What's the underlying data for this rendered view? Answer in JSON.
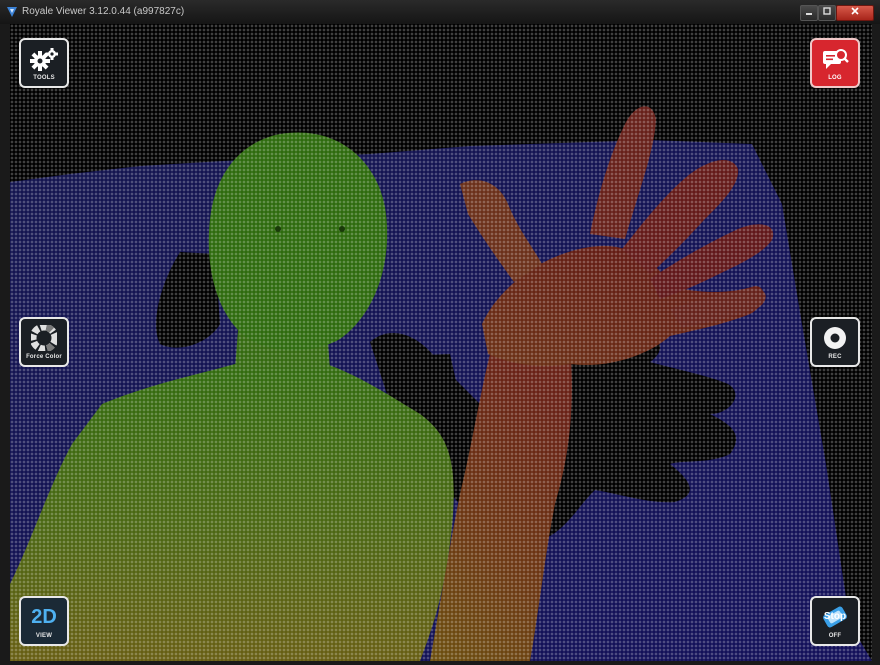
{
  "window": {
    "title": "Royale Viewer 3.12.0.44 (a997827c)"
  },
  "toolbar": {
    "tools_label": "TOOLS",
    "log_label": "LOG",
    "force_color_label": "Force Color",
    "rec_label": "REC",
    "view_mode": "2D",
    "view_label": "VIEW",
    "stop_label": "Stop",
    "off_label": "OFF"
  },
  "icons": [
    "gears-icon",
    "log-search-icon",
    "color-wheel-icon",
    "record-icon",
    "stop-icon"
  ],
  "colors": {
    "log_button": "#d7262e",
    "near": "#e02020",
    "mid": "#ffd020",
    "body": "#6cf020",
    "far": "#2a2ad0",
    "view_accent": "#4fb1f0"
  }
}
